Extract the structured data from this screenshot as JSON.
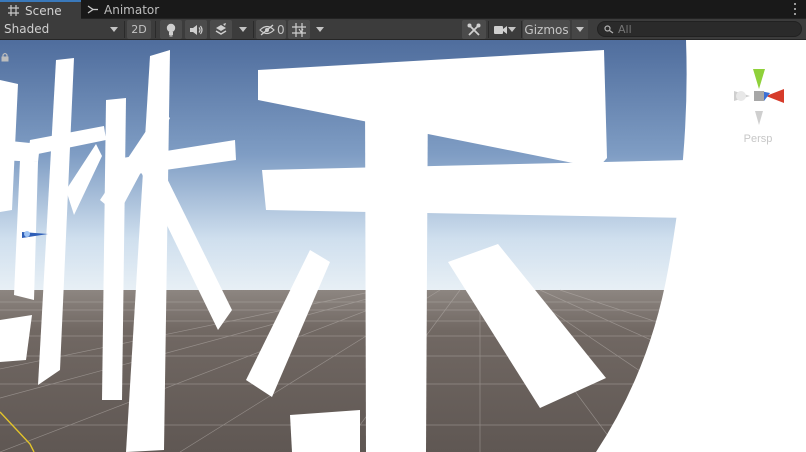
{
  "tabs": [
    {
      "label": "Scene",
      "icon": "grid-icon",
      "active": true
    },
    {
      "label": "Animator",
      "icon": "animator-icon",
      "active": false
    }
  ],
  "toolbar": {
    "shading_mode": "Shaded",
    "mode_2d_label": "2D",
    "hidden_count": "0",
    "gizmos_label": "Gizmos",
    "search_placeholder": "All"
  },
  "viewport": {
    "projection_label": "Persp",
    "sky_top_color": "#4e6b9b",
    "sky_horizon_color": "#dfe9f2",
    "ground_color": "#6b625d",
    "text_color": "#ffffff",
    "axis_colors": {
      "x": "#d63b2a",
      "y": "#8fd13a",
      "z": "#3a6fd6"
    }
  }
}
